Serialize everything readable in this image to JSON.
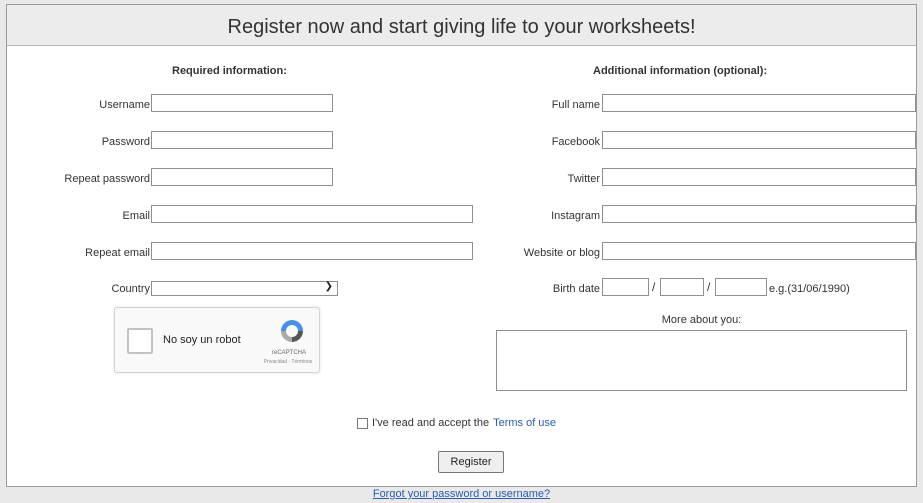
{
  "banner": {
    "title": "Register now and start giving life to your worksheets!"
  },
  "required": {
    "title": "Required information:",
    "fields": {
      "username": {
        "label": "Username",
        "value": ""
      },
      "password": {
        "label": "Password",
        "value": ""
      },
      "repeat_password": {
        "label": "Repeat password",
        "value": ""
      },
      "email": {
        "label": "Email",
        "value": ""
      },
      "repeat_email": {
        "label": "Repeat email",
        "value": ""
      },
      "country": {
        "label": "Country",
        "value": ""
      }
    }
  },
  "optional": {
    "title": "Additional information (optional):",
    "fields": {
      "full_name": {
        "label": "Full name",
        "value": ""
      },
      "facebook": {
        "label": "Facebook",
        "value": ""
      },
      "twitter": {
        "label": "Twitter",
        "value": ""
      },
      "instagram": {
        "label": "Instagram",
        "value": ""
      },
      "website": {
        "label": "Website or blog",
        "value": ""
      },
      "birth_date": {
        "label": "Birth date",
        "separator": "/",
        "hint": "e.g.(31/06/1990)"
      }
    },
    "more_about": {
      "label": "More about you:",
      "value": ""
    }
  },
  "captcha": {
    "label": "No soy un robot",
    "brand": "reCAPTCHA",
    "links": "Privacidad - Términos"
  },
  "terms": {
    "text": "I've read and accept the",
    "link": "Terms of use"
  },
  "register_button": "Register",
  "forgot_link": "Forgot your password or username?",
  "colors": {
    "banner_bg": "#ececec",
    "link": "#2a5db0",
    "recaptcha_blue": "#4a90e2"
  }
}
